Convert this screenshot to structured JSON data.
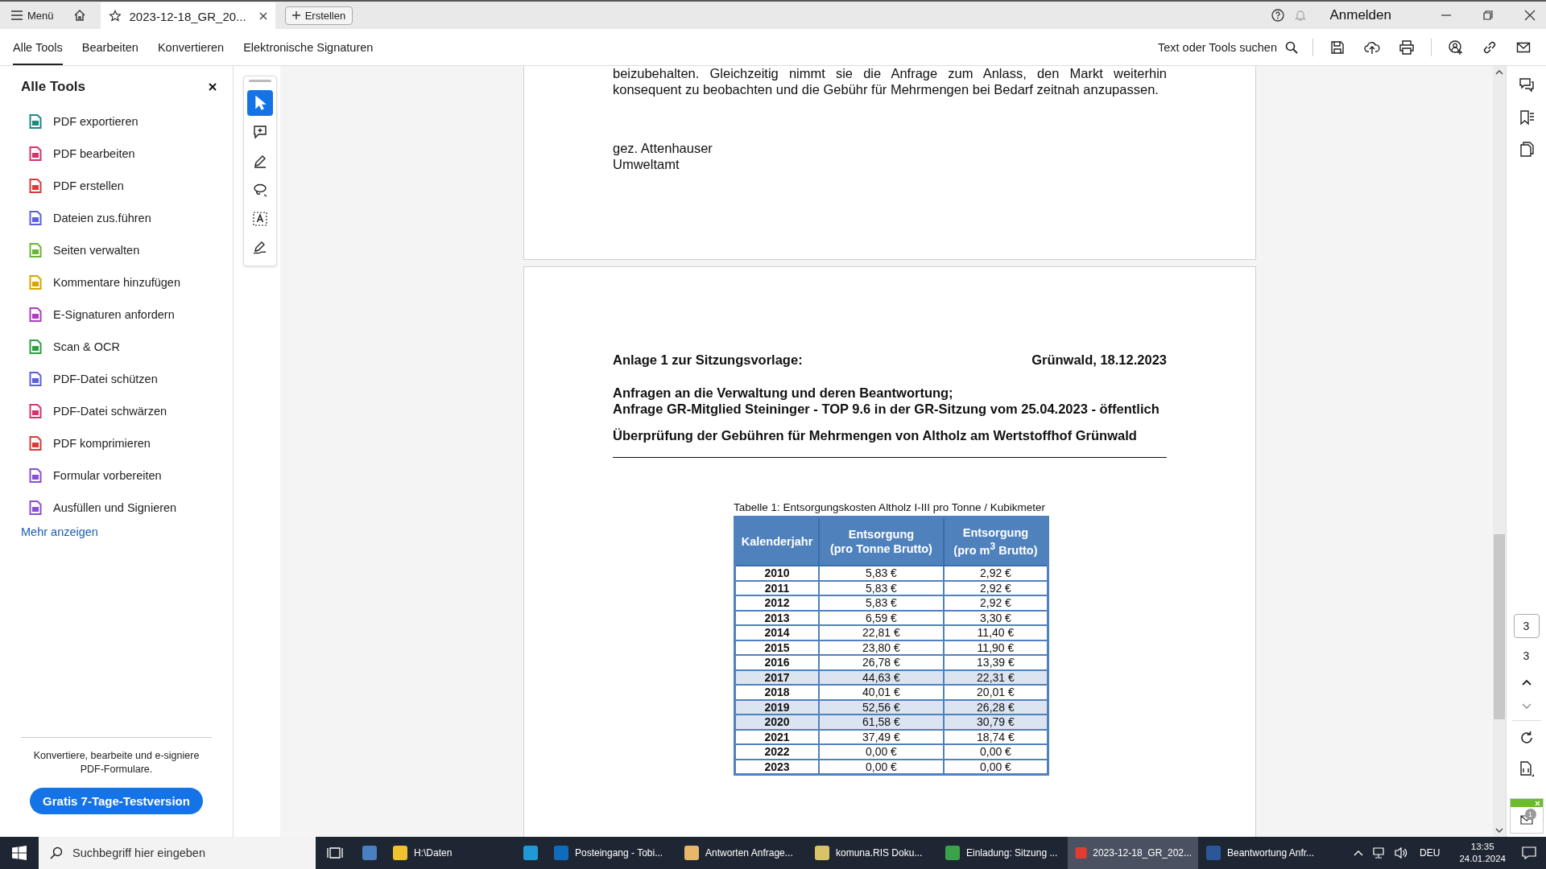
{
  "title_bar": {
    "menu": "Menü",
    "tab_title": "2023-12-18_GR_20...",
    "create_button": "Erstellen",
    "sign_in": "Anmelden"
  },
  "tabs": [
    {
      "label": "Alle Tools",
      "selected": true
    },
    {
      "label": "Bearbeiten",
      "selected": false
    },
    {
      "label": "Konvertieren",
      "selected": false
    },
    {
      "label": "Elektronische Signaturen",
      "selected": false
    }
  ],
  "search": {
    "placeholder": "Text oder Tools suchen"
  },
  "sidebar": {
    "title": "Alle Tools",
    "items": [
      {
        "label": "PDF exportieren",
        "color": "#1a8a84"
      },
      {
        "label": "PDF bearbeiten",
        "color": "#d6336c"
      },
      {
        "label": "PDF erstellen",
        "color": "#d93a3a"
      },
      {
        "label": "Dateien zus.führen",
        "color": "#5b5fe0"
      },
      {
        "label": "Seiten verwalten",
        "color": "#6ab531"
      },
      {
        "label": "Kommentare hinzufügen",
        "color": "#d9a400"
      },
      {
        "label": "E-Signaturen anfordern",
        "color": "#b03cc4"
      },
      {
        "label": "Scan & OCR",
        "color": "#2f9e44"
      },
      {
        "label": "PDF-Datei schützen",
        "color": "#5b5fe0"
      },
      {
        "label": "PDF-Datei schwärzen",
        "color": "#d6336c"
      },
      {
        "label": "PDF komprimieren",
        "color": "#d93a3a"
      },
      {
        "label": "Formular vorbereiten",
        "color": "#8a4fd8"
      },
      {
        "label": "Ausfüllen und Signieren",
        "color": "#8a4fd8"
      }
    ],
    "more_link": "Mehr anzeigen",
    "promo_text": "Konvertiere, bearbeite und e-signiere PDF-Formulare.",
    "promo_button": "Gratis 7-Tage-Testversion"
  },
  "tools": [
    {
      "kind": "pointer",
      "selected": true
    },
    {
      "kind": "comment",
      "selected": false
    },
    {
      "kind": "pen",
      "selected": false
    },
    {
      "kind": "lasso",
      "selected": false
    },
    {
      "kind": "textselect",
      "selected": false
    },
    {
      "kind": "sign",
      "selected": false
    }
  ],
  "document": {
    "paragraph": "beizubehalten. Gleichzeitig nimmt sie die Anfrage zum Anlass, den Markt weiterhin konsequent zu beobachten und die Gebühr für Mehrmengen bei Bedarf zeitnah anzupassen.",
    "signature": [
      "gez. Attenhauser",
      "Umweltamt"
    ],
    "attachment_label": "Anlage 1 zur Sitzungsvorlage:",
    "place_date": "Grünwald, 18.12.2023",
    "subject_lines": [
      "Anfragen an die Verwaltung und deren Beantwortung;",
      "Anfrage GR-Mitglied Steininger - TOP 9.6 in der GR-Sitzung vom 25.04.2023 - öffentlich"
    ],
    "heading": "Überprüfung der Gebühren für Mehrmengen von Altholz am Wertstoffhof Grünwald",
    "table": {
      "caption": "Tabelle 1: Entsorgungskosten Altholz I-III pro Tonne / Kubikmeter",
      "columns": [
        [
          "Kalenderjahr"
        ],
        [
          "Entsorgung",
          "(pro Tonne Brutto)"
        ],
        [
          "Entsorgung",
          "(pro m$^{3}$ Brutto)"
        ]
      ],
      "rows": [
        {
          "year": "2010",
          "per_tonne": "5,83 €",
          "per_m3": "2,92 €",
          "highlighted": false
        },
        {
          "year": "2011",
          "per_tonne": "5,83 €",
          "per_m3": "2,92 €",
          "highlighted": false
        },
        {
          "year": "2012",
          "per_tonne": "5,83 €",
          "per_m3": "2,92 €",
          "highlighted": false
        },
        {
          "year": "2013",
          "per_tonne": "6,59 €",
          "per_m3": "3,30 €",
          "highlighted": false
        },
        {
          "year": "2014",
          "per_tonne": "22,81 €",
          "per_m3": "11,40 €",
          "highlighted": false
        },
        {
          "year": "2015",
          "per_tonne": "23,80 €",
          "per_m3": "11,90 €",
          "highlighted": false
        },
        {
          "year": "2016",
          "per_tonne": "26,78 €",
          "per_m3": "13,39 €",
          "highlighted": false
        },
        {
          "year": "2017",
          "per_tonne": "44,63 €",
          "per_m3": "22,31 €",
          "highlighted": true
        },
        {
          "year": "2018",
          "per_tonne": "40,01 €",
          "per_m3": "20,01 €",
          "highlighted": false
        },
        {
          "year": "2019",
          "per_tonne": "52,56 €",
          "per_m3": "26,28 €",
          "highlighted": true
        },
        {
          "year": "2020",
          "per_tonne": "61,58 €",
          "per_m3": "30,79 €",
          "highlighted": true
        },
        {
          "year": "2021",
          "per_tonne": "37,49 €",
          "per_m3": "18,74 €",
          "highlighted": false
        },
        {
          "year": "2022",
          "per_tonne": "0,00 €",
          "per_m3": "0,00 €",
          "highlighted": false
        },
        {
          "year": "2023",
          "per_tonne": "0,00 €",
          "per_m3": "0,00 €",
          "highlighted": false
        }
      ]
    }
  },
  "pager": {
    "current": "3",
    "total": "3"
  },
  "notification": {
    "count": "1"
  },
  "taskbar": {
    "search_placeholder": "Suchbegriff hier eingeben",
    "apps": [
      {
        "color": "#4a7fc1",
        "selected": false
      },
      {
        "label": "H:\\Daten",
        "color": "#f2c12e",
        "selected": false
      },
      {
        "color": "#1e9bd7",
        "selected": false
      },
      {
        "label": "Posteingang - Tobi...",
        "color": "#0f6cbd",
        "selected": false
      },
      {
        "label": "Antworten Anfrage...",
        "color": "#e8b86a",
        "selected": false
      },
      {
        "label": "komuna.RIS Doku...",
        "color": "#d9c36a",
        "selected": false
      },
      {
        "label": "Einladung: Sitzung ...",
        "color": "#3aa34a",
        "selected": false
      },
      {
        "label": "2023-12-18_GR_202...",
        "color": "#e03c31",
        "selected": true
      },
      {
        "label": "Beantwortung Anfr...",
        "color": "#2b579a",
        "selected": false
      }
    ],
    "language": "DEU",
    "time": "13:35",
    "date": "24.01.2024"
  }
}
